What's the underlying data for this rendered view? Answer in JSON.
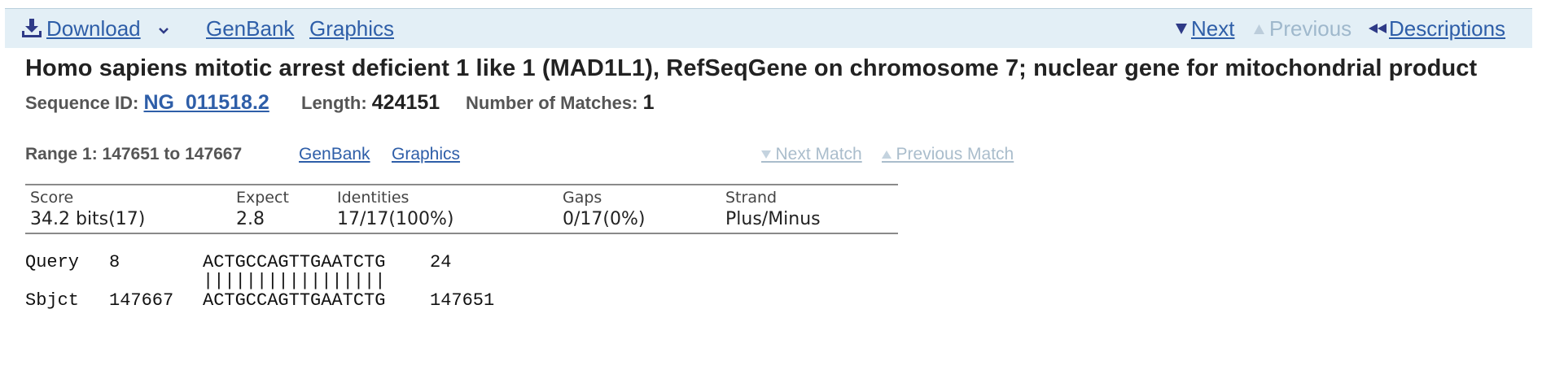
{
  "toolbar": {
    "download_label": "Download",
    "genbank_label": "GenBank",
    "graphics_label": "Graphics",
    "next_label": "Next",
    "previous_label": "Previous",
    "descriptions_label": "Descriptions"
  },
  "title": "Homo sapiens mitotic arrest deficient 1 like 1 (MAD1L1), RefSeqGene on chromosome 7; nuclear gene for mitochondrial product",
  "meta": {
    "sequence_id_label": "Sequence ID:",
    "sequence_id": "NG_011518.2",
    "length_label": "Length:",
    "length": "424151",
    "matches_label": "Number of Matches:",
    "matches": "1"
  },
  "range": {
    "label": "Range 1: 147651 to 147667",
    "genbank_label": "GenBank",
    "graphics_label": "Graphics",
    "next_match_label": "Next Match",
    "previous_match_label": "Previous Match"
  },
  "stats": {
    "headers": [
      "Score",
      "Expect",
      "Identities",
      "Gaps",
      "Strand"
    ],
    "values": [
      "34.2 bits(17)",
      "2.8",
      "17/17(100%)",
      "0/17(0%)",
      "Plus/Minus"
    ]
  },
  "alignment": {
    "query_label": "Query",
    "query_start": "8",
    "query_seq": "ACTGCCAGTTGAATCTG",
    "query_end": "24",
    "match_line": "|||||||||||||||||",
    "sbjct_label": "Sbjct",
    "sbjct_start": "147667",
    "sbjct_seq": "ACTGCCAGTTGAATCTG",
    "sbjct_end": "147651"
  },
  "colors": {
    "toolbar_bg": "#e3eff6",
    "link": "#2e5ea8",
    "disabled": "#9fb8cc"
  }
}
